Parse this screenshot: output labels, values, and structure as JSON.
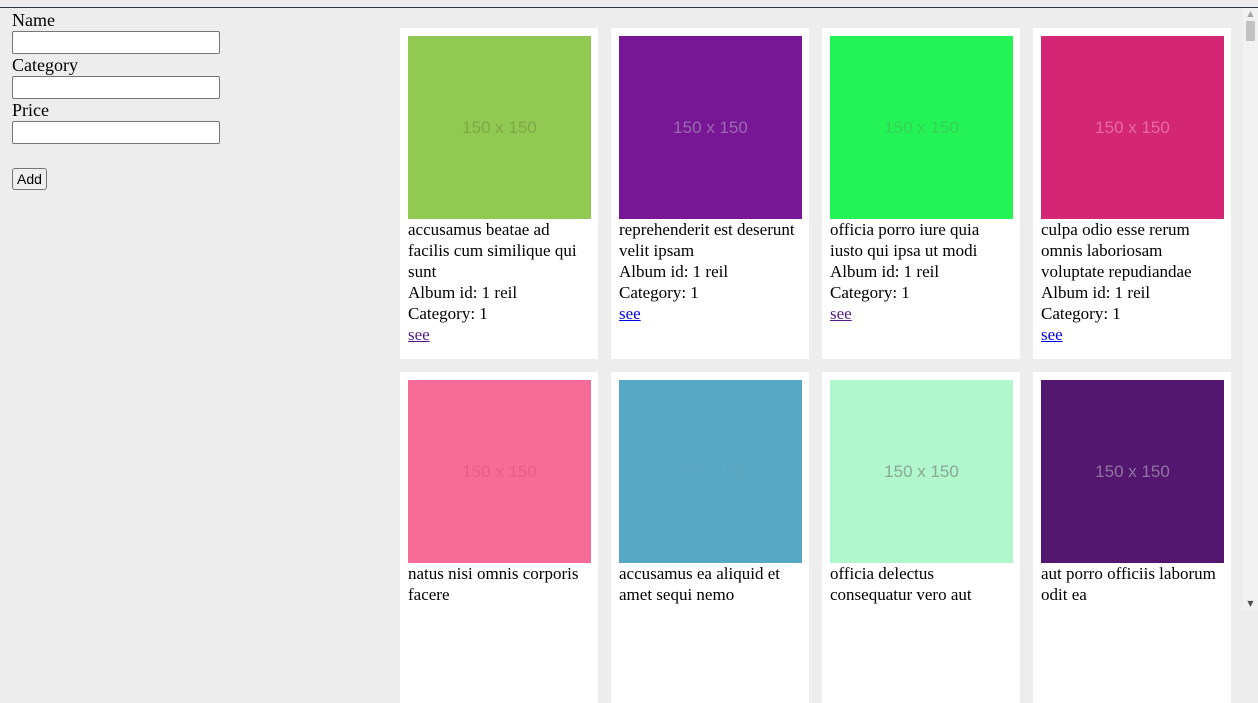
{
  "form": {
    "name_label": "Name",
    "name_value": "",
    "category_label": "Category",
    "category_value": "",
    "price_label": "Price",
    "price_value": "",
    "add_label": "Add"
  },
  "colors": {
    "page_background": "#ededed",
    "visited_link": "#551a8b",
    "unvisited_link": "#0000ee"
  },
  "cards": [
    {
      "placeholder": "150 x 150",
      "color": "#92c952",
      "text_color": "#7fa948",
      "title": "accusamus beatae ad facilis cum similique qui sunt",
      "album": "Album id: 1 reil",
      "category": "Category: 1",
      "link": "see",
      "visited": true
    },
    {
      "placeholder": "150 x 150",
      "color": "#771796",
      "text_color": "#9a6aaf",
      "title": "reprehenderit est deserunt velit ipsam",
      "album": "Album id: 1 reil",
      "category": "Category: 1",
      "link": "see",
      "visited": false
    },
    {
      "placeholder": "150 x 150",
      "color": "#24f355",
      "text_color": "#37d25a",
      "title": "officia porro iure quia iusto qui ipsa ut modi",
      "album": "Album id: 1 reil",
      "category": "Category: 1",
      "link": "see",
      "visited": true
    },
    {
      "placeholder": "150 x 150",
      "color": "#d32776",
      "text_color": "#e86aa2",
      "title": "culpa odio esse rerum omnis laboriosam voluptate repudiandae",
      "album": "Album id: 1 reil",
      "category": "Category: 1",
      "link": "see",
      "visited": false
    },
    {
      "placeholder": "150 x 150",
      "color": "#f66b97",
      "text_color": "#e36089",
      "title": "natus nisi omnis corporis facere",
      "album": "",
      "category": "",
      "link": "",
      "visited": false
    },
    {
      "placeholder": "150 x 150",
      "color": "#56a8c5",
      "text_color": "#5fa9c2",
      "title": "accusamus ea aliquid et amet sequi nemo",
      "album": "",
      "category": "",
      "link": "",
      "visited": false
    },
    {
      "placeholder": "150 x 150",
      "color": "#b0f7cc",
      "text_color": "#8aa797",
      "title": "officia delectus consequatur vero aut",
      "album": "",
      "category": "",
      "link": "",
      "visited": false
    },
    {
      "placeholder": "150 x 150",
      "color": "#54176f",
      "text_color": "#8d74a0",
      "title": "aut porro officiis laborum odit ea",
      "album": "",
      "category": "",
      "link": "",
      "visited": false
    }
  ]
}
